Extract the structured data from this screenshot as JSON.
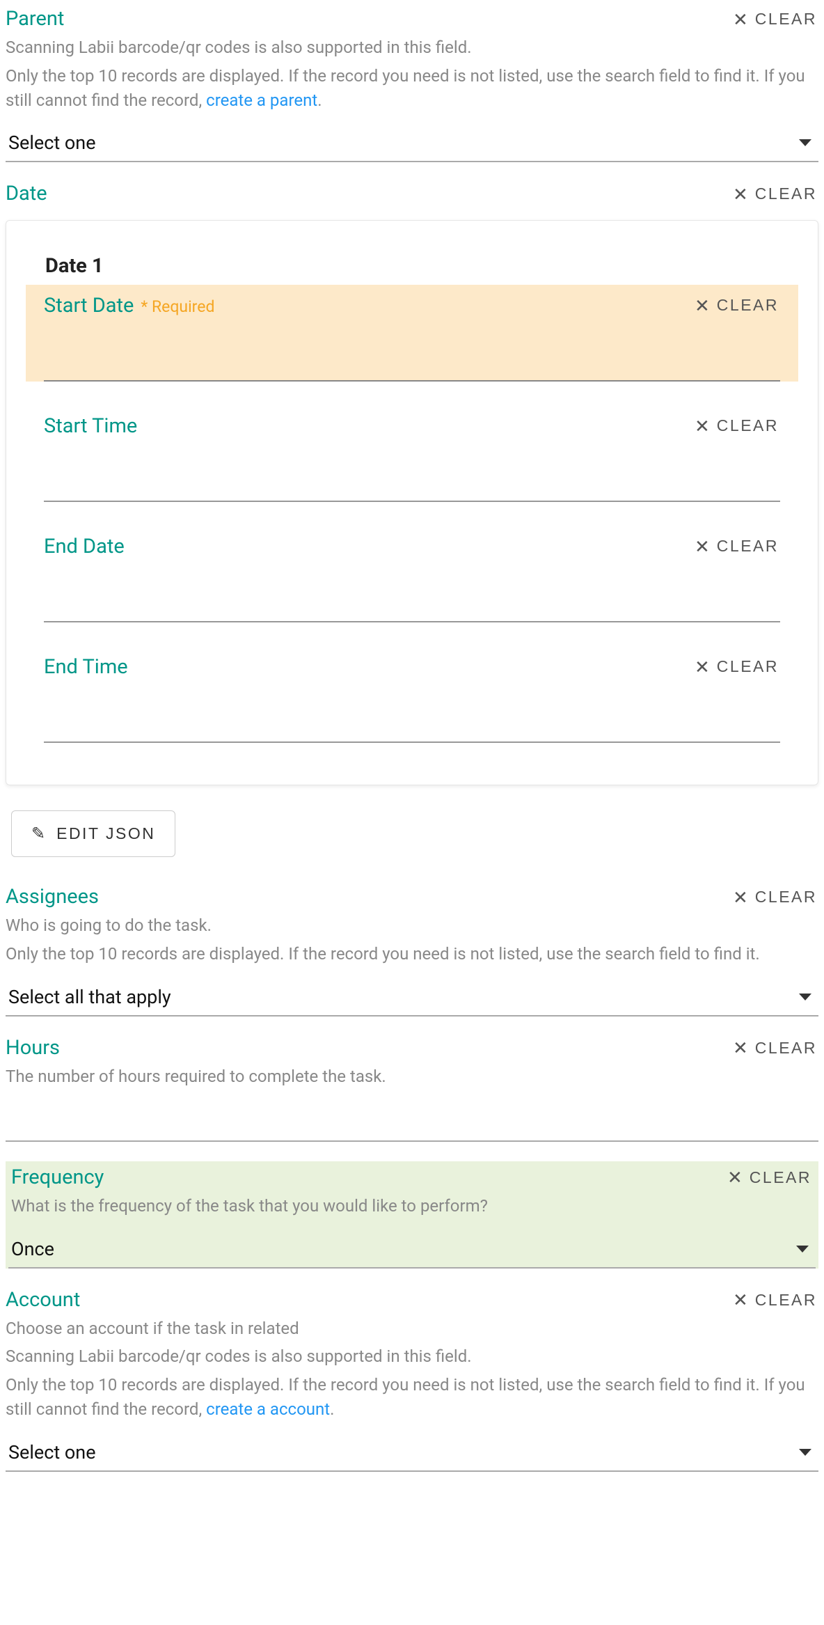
{
  "clear_label": "CLEAR",
  "parent": {
    "label": "Parent",
    "help1": "Scanning Labii barcode/qr codes is also supported in this field.",
    "help2_prefix": "Only the top 10 records are displayed. If the record you need is not listed, use the search field to find it. If you still cannot find the record, ",
    "help2_link": "create a parent",
    "help2_suffix": ".",
    "placeholder": "Select one"
  },
  "date": {
    "label": "Date",
    "panel_title": "Date 1",
    "start_date": {
      "label": "Start Date",
      "required_tag": "* Required"
    },
    "start_time": {
      "label": "Start Time"
    },
    "end_date": {
      "label": "End Date"
    },
    "end_time": {
      "label": "End Time"
    }
  },
  "edit_json_label": "EDIT JSON",
  "assignees": {
    "label": "Assignees",
    "help1": "Who is going to do the task.",
    "help2": "Only the top 10 records are displayed. If the record you need is not listed, use the search field to find it.",
    "placeholder": "Select all that apply"
  },
  "hours": {
    "label": "Hours",
    "help": "The number of hours required to complete the task."
  },
  "frequency": {
    "label": "Frequency",
    "help": "What is the frequency of the task that you would like to perform?",
    "value": "Once"
  },
  "account": {
    "label": "Account",
    "help1": "Choose an account if the task in related",
    "help2": "Scanning Labii barcode/qr codes is also supported in this field.",
    "help3_prefix": "Only the top 10 records are displayed. If the record you need is not listed, use the search field to find it. If you still cannot find the record, ",
    "help3_link": "create a account",
    "help3_suffix": ".",
    "placeholder": "Select one"
  }
}
